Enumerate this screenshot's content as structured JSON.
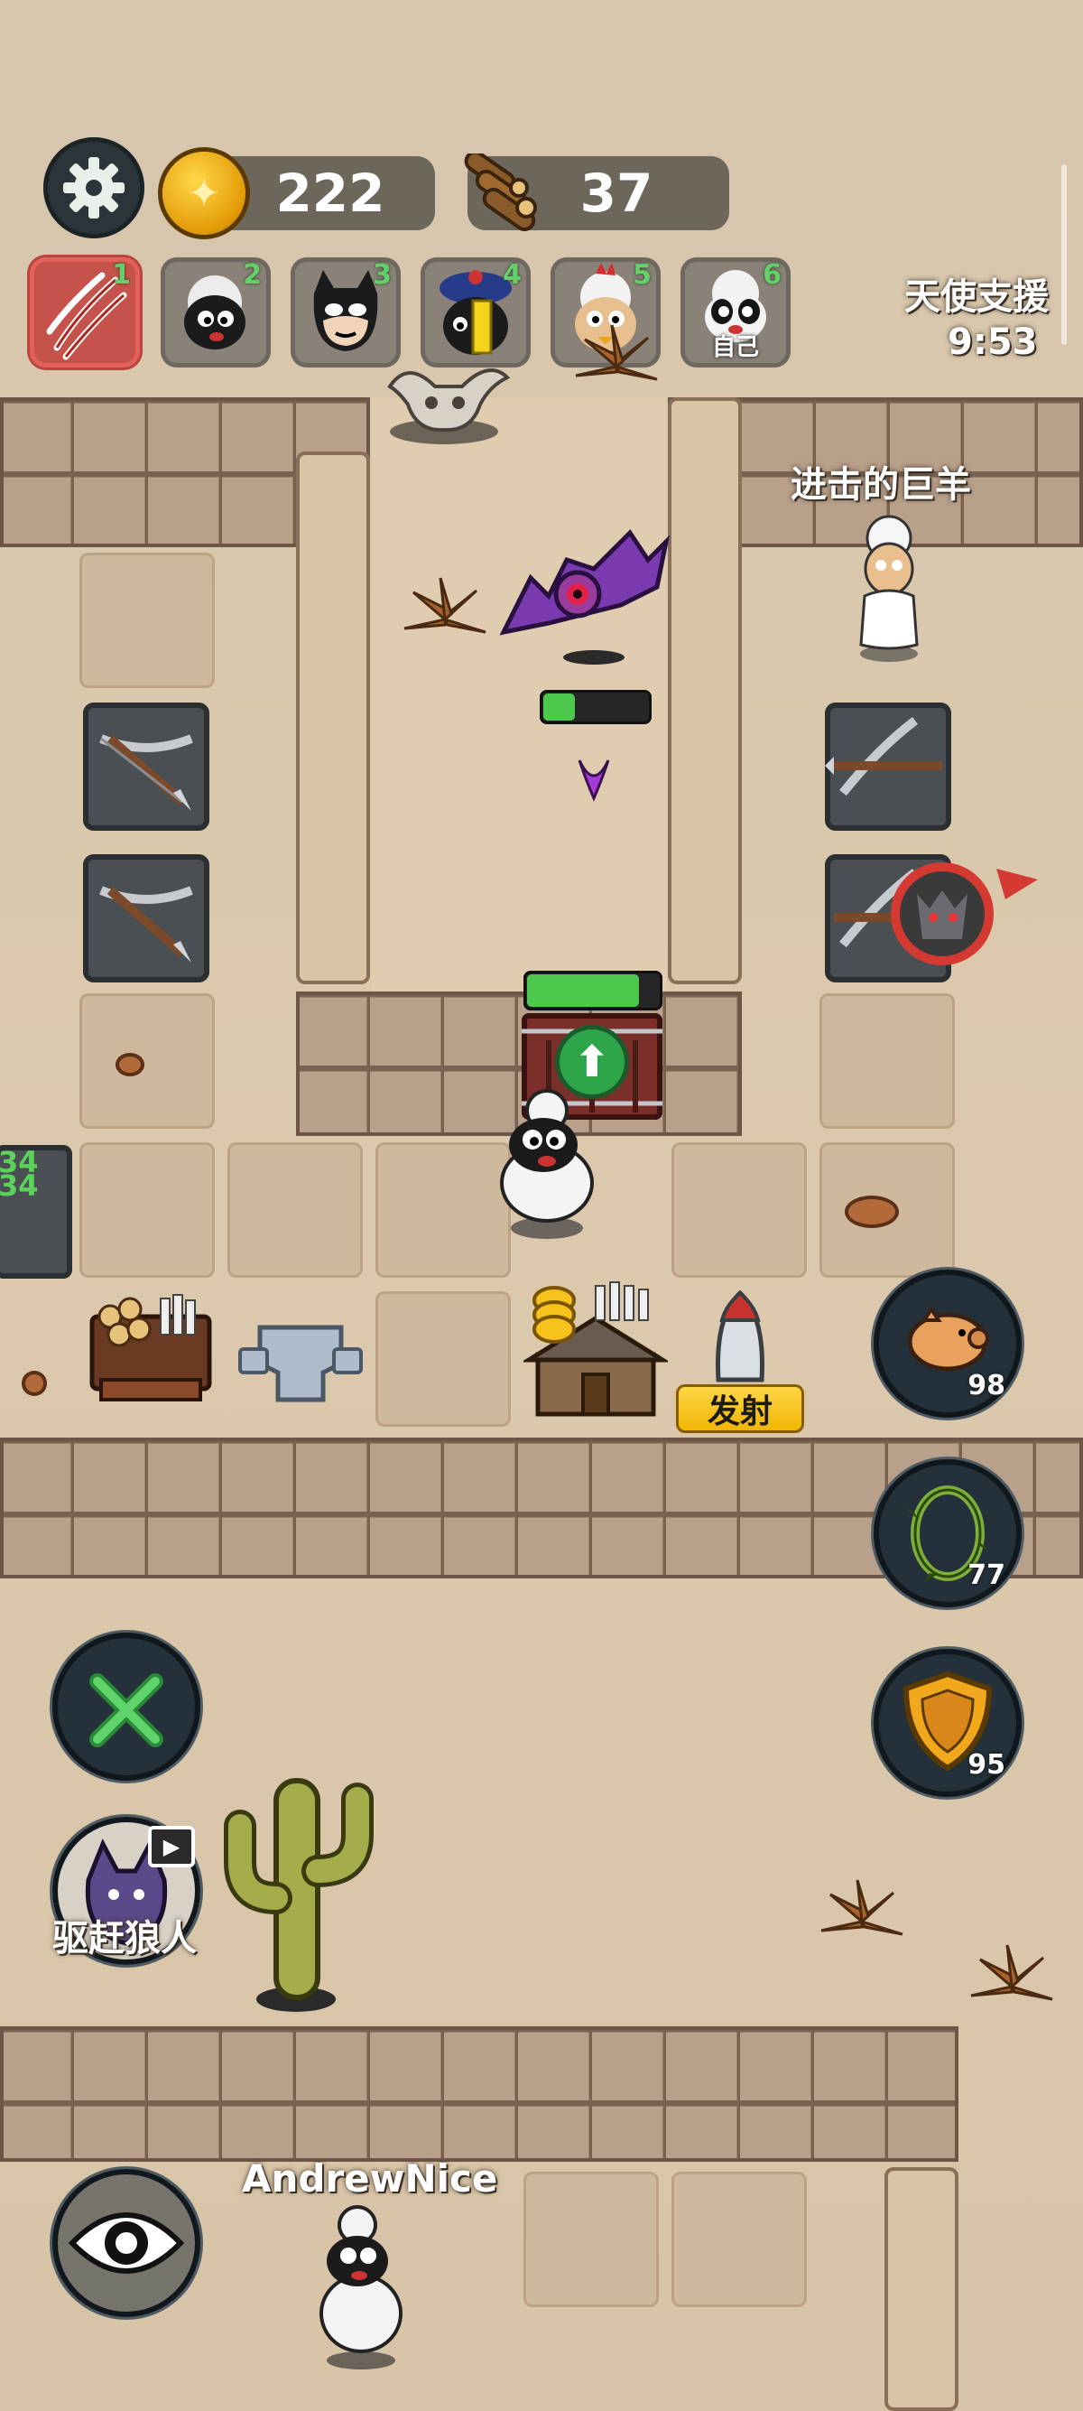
{
  "hud": {
    "gold": "222",
    "wood": "37",
    "angel_support_label": "天使支援",
    "angel_support_timer": "9:53"
  },
  "team_slots": [
    {
      "num": "1",
      "icon": "claw-slash-icon",
      "active": true
    },
    {
      "num": "2",
      "icon": "black-sheep-icon"
    },
    {
      "num": "3",
      "icon": "masked-hero-sheep-icon"
    },
    {
      "num": "4",
      "icon": "jiangshi-sheep-icon"
    },
    {
      "num": "5",
      "icon": "chicken-hat-sheep-icon"
    },
    {
      "num": "6",
      "icon": "panda-sheep-icon",
      "label": "自己"
    }
  ],
  "board": {
    "giant_sheep_label": "进击的巨羊",
    "launch_label": "发射",
    "gate_health_fraction": 0.85,
    "bat_health_fraction": 0.3,
    "player_name": "AndrewNice",
    "side_tower_numbers": [
      "34",
      "34"
    ],
    "colors": {
      "accent_green": "#4cc84c",
      "danger_red": "#d43a32",
      "button_yellow": "#f7c21c"
    }
  },
  "side_buttons": [
    {
      "name": "piggy-bank",
      "icon": "pig-icon",
      "count": "98"
    },
    {
      "name": "thorn-ring",
      "icon": "thorn-vine-icon",
      "count": "77"
    },
    {
      "name": "shield",
      "icon": "shield-icon",
      "count": "95"
    }
  ],
  "left_buttons": {
    "build_icon": "wrench-hammer-icon",
    "wolf_label": "驱赶狼人",
    "view_icon": "eye-icon"
  }
}
